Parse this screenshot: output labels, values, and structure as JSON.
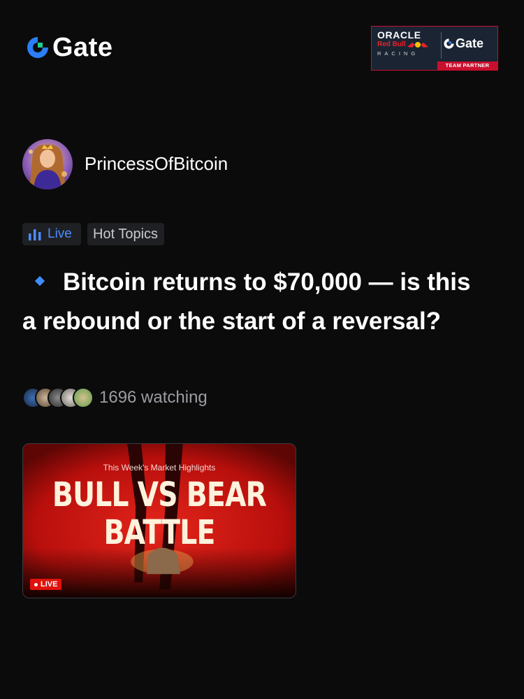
{
  "header": {
    "brand_name": "Gate",
    "partner": {
      "oracle": "ORACLE",
      "redbull": "Red Bull",
      "racing": "RACING",
      "gate": "Gate",
      "strip": "TEAM PARTNER"
    }
  },
  "post": {
    "author": "PrincessOfBitcoin",
    "tags": [
      {
        "label": "Live",
        "icon": "bar-chart-icon",
        "color": "#4e8cff"
      },
      {
        "label": "Hot Topics"
      }
    ],
    "headline": "Bitcoin returns to $70,000 — is this a rebound or the start of a reversal?",
    "watching": "1696 watching",
    "video": {
      "subtitle": "This Week's Market Highlights",
      "title_line1": "BULL VS BEAR",
      "title_line2": "BATTLE",
      "live_label": "LIVE"
    }
  },
  "colors": {
    "background": "#0b0b0c",
    "accent": "#3f8dfb",
    "live_red": "#e0120c"
  }
}
